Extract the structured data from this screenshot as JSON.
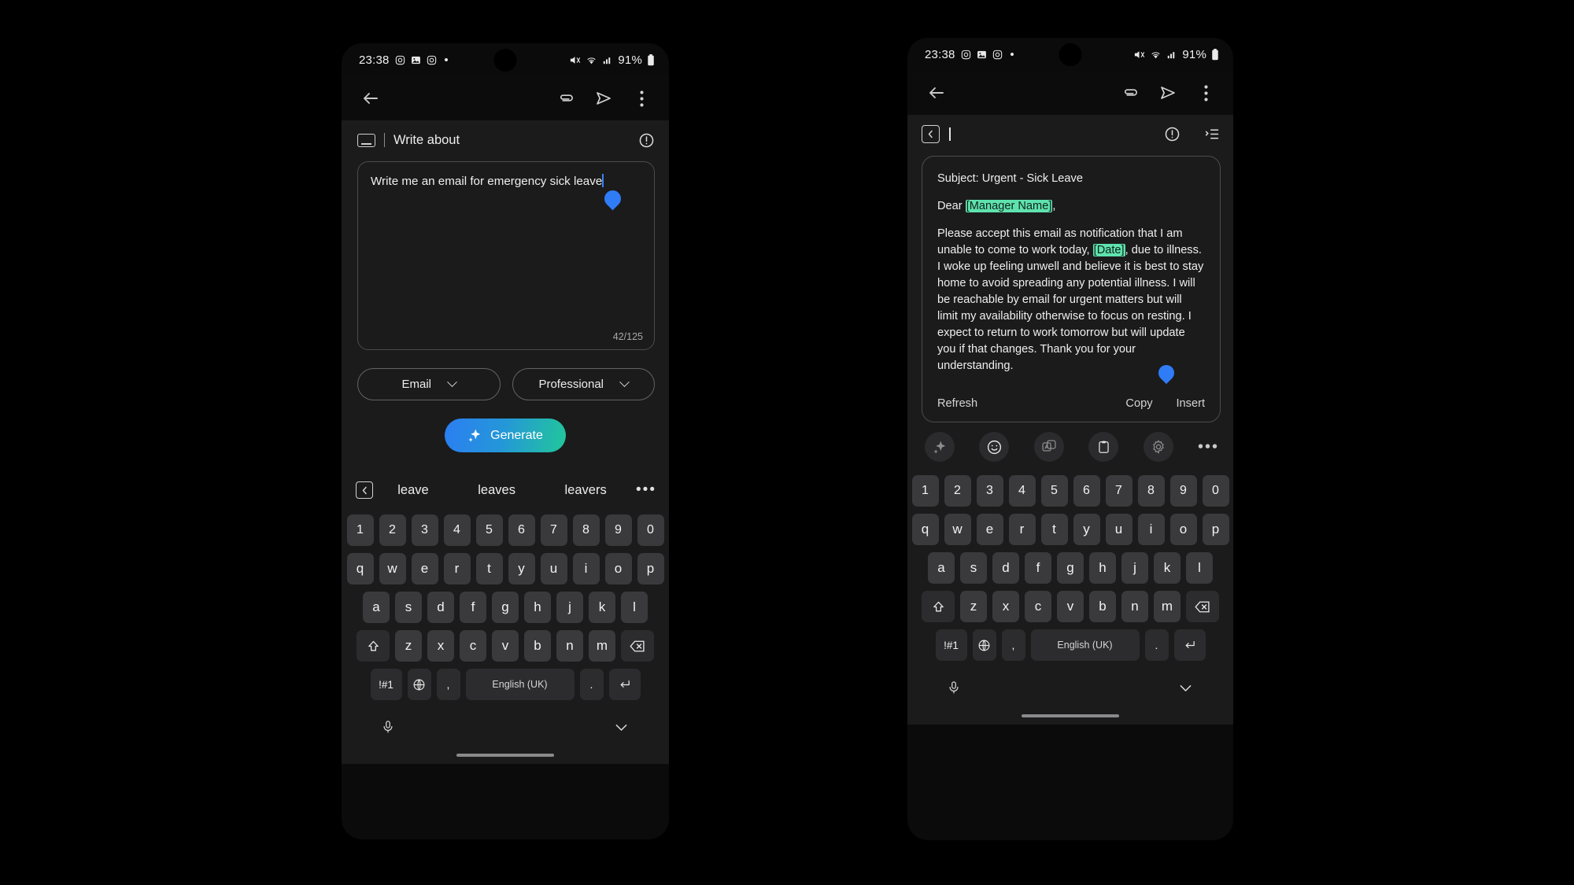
{
  "screen": {
    "background": "#000000",
    "accent_blue": "#2f7cf6",
    "accent_teal": "#22c79a",
    "highlight_green": "#5fe3ae",
    "panel_bg": "#1b1b1c"
  },
  "status_bar": {
    "time": "23:38",
    "left_icons": [
      "instagram-icon",
      "image-icon",
      "instagram-icon",
      "dot-icon"
    ],
    "right_icons": [
      "mute-icon",
      "wifi-icon",
      "signal-icon"
    ],
    "battery_percent": "91%",
    "battery_icon": "battery-icon"
  },
  "left_phone": {
    "toolbar": {
      "back_icon": "back-arrow-icon",
      "attach_icon": "paperclip-icon",
      "send_icon": "send-icon",
      "overflow_icon": "three-dot-menu-icon"
    },
    "compose": {
      "keyboard_icon": "keyboard-icon",
      "title": "Write about",
      "info_icon": "info-circle-icon",
      "input_value": "Write me an email for emergency sick leave",
      "input_placeholder": "Write about",
      "char_counter": "42/125",
      "drag_handle_icon": "text-drag-handle-icon"
    },
    "options": {
      "format": {
        "value": "Email",
        "chevron_icon": "chevron-down-icon"
      },
      "tone": {
        "value": "Professional",
        "chevron_icon": "chevron-down-icon"
      }
    },
    "generate_button": {
      "label": "Generate",
      "icon": "sparkle-icon"
    },
    "suggestions": {
      "collapse_icon": "collapse-left-icon",
      "words": [
        "leave",
        "leaves",
        "leavers"
      ],
      "more_icon": "ellipsis-icon"
    }
  },
  "right_phone": {
    "toolbar": {
      "back_icon": "back-arrow-icon",
      "attach_icon": "paperclip-icon",
      "send_icon": "send-icon",
      "overflow_icon": "three-dot-menu-icon"
    },
    "result_header": {
      "collapse_icon": "collapse-left-icon",
      "cursor_icon": "text-cursor-icon",
      "info_icon": "info-circle-icon",
      "list_icon": "list-format-icon"
    },
    "result": {
      "subject": "Subject: Urgent - Sick Leave",
      "salutation_prefix": "Dear ",
      "salutation_placeholder": "[Manager Name]",
      "salutation_suffix": ",",
      "body_part1": "Please accept this email as notification that I am unable to come to work today, ",
      "body_placeholder": "[Date]",
      "body_part2": ", due to illness. I woke up feeling unwell and believe it is best to stay home to avoid spreading any potential illness.  I will be reachable by email for urgent matters but will limit my availability otherwise to focus on resting. I expect to return to work tomorrow but will update you if that changes.  Thank you for your understanding.",
      "drag_handle_icon": "text-drag-handle-icon"
    },
    "result_actions": {
      "refresh": "Refresh",
      "copy": "Copy",
      "insert": "Insert"
    },
    "icon_bar": {
      "items": [
        "sparkle-icon",
        "emoji-icon",
        "translate-icon",
        "clipboard-icon",
        "settings-gear-icon"
      ],
      "more_icon": "ellipsis-icon"
    }
  },
  "keyboard": {
    "row_numbers": [
      "1",
      "2",
      "3",
      "4",
      "5",
      "6",
      "7",
      "8",
      "9",
      "0"
    ],
    "row_top": [
      "q",
      "w",
      "e",
      "r",
      "t",
      "y",
      "u",
      "i",
      "o",
      "p"
    ],
    "row_home": [
      "a",
      "s",
      "d",
      "f",
      "g",
      "h",
      "j",
      "k",
      "l"
    ],
    "row_bottom": [
      "z",
      "x",
      "c",
      "v",
      "b",
      "n",
      "m"
    ],
    "shift_icon": "shift-up-icon",
    "backspace_icon": "backspace-icon",
    "symbols_key": "!#1",
    "globe_icon": "globe-language-icon",
    "comma_key": ",",
    "space_label": "English (UK)",
    "period_key": ".",
    "enter_icon": "enter-return-icon",
    "mic_icon": "microphone-icon",
    "hide_icon": "chevron-down-hide-keyboard-icon"
  }
}
